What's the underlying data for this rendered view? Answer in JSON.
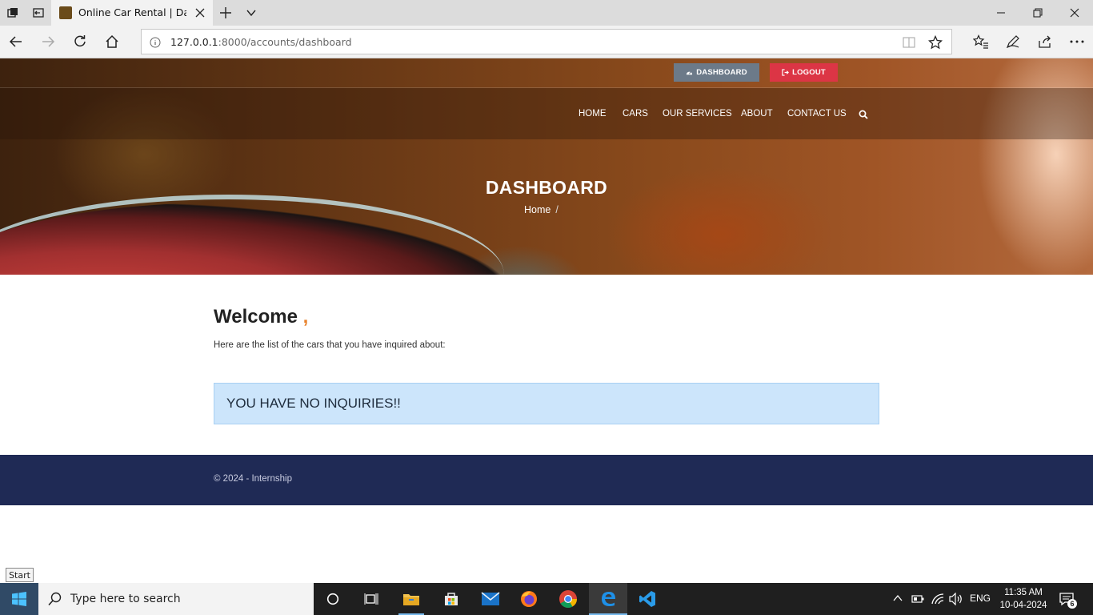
{
  "browser": {
    "tab_title": "Online Car Rental | Dashboard",
    "url_host": "127.0.0.1",
    "url_rest": ":8000/accounts/dashboard"
  },
  "topbar": {
    "dashboard_label": "DASHBOARD",
    "logout_label": "LOGOUT",
    "dashboard_color": "#6c7a89",
    "logout_color": "#dc3545"
  },
  "nav": {
    "items": [
      "HOME",
      "CARS",
      "OUR SERVICES",
      "ABOUT",
      "CONTACT US"
    ]
  },
  "hero": {
    "title": "DASHBOARD",
    "breadcrumb_home": "Home",
    "breadcrumb_sep": "/"
  },
  "content": {
    "welcome": "Welcome",
    "welcome_comma": ",",
    "intro": "Here are the list of the cars that you have inquired about:",
    "alert": "YOU HAVE NO INQUIRIES!!"
  },
  "footer": {
    "text": "© 2024 - Internship",
    "color": "#1f2a55"
  },
  "tooltip": {
    "start": "Start"
  },
  "taskbar": {
    "search_placeholder": "Type here to search",
    "language": "ENG",
    "time": "11:35 AM",
    "date": "10-04-2024",
    "notification_count": "6"
  }
}
